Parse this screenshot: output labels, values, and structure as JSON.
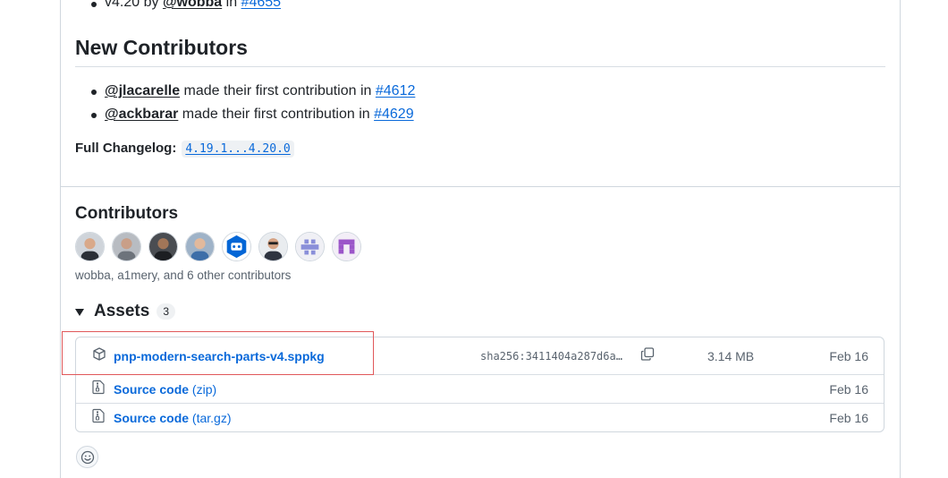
{
  "top_item": {
    "prefix": "v4.20 by ",
    "mention": "@wobba",
    "mid": " in ",
    "pr": "#4655"
  },
  "new_contributors": {
    "heading": "New Contributors",
    "items": [
      {
        "user": "@jlacarelle",
        "text": " made their first contribution in ",
        "pr": "#4612"
      },
      {
        "user": "@ackbarar",
        "text": " made their first contribution in ",
        "pr": "#4629"
      }
    ]
  },
  "changelog": {
    "label": "Full Changelog:",
    "link": "4.19.1...4.20.0"
  },
  "contributors": {
    "heading": "Contributors",
    "summary": "wobba, a1mery, and 6 other contributors"
  },
  "assets": {
    "heading": "Assets",
    "count": "3",
    "rows": [
      {
        "name": "pnp-modern-search-parts-v4.sppkg",
        "sha": "sha256:3411404a287d6a…",
        "size": "3.14 MB",
        "date": "Feb 16"
      },
      {
        "name": "Source code",
        "suffix": "(zip)",
        "date": "Feb 16"
      },
      {
        "name": "Source code",
        "suffix": "(tar.gz)",
        "date": "Feb 16"
      }
    ]
  },
  "colors": {
    "link": "#0969da",
    "text": "#1f2328",
    "muted": "#59636e",
    "border": "#d0d7de",
    "highlight": "#e0585a"
  }
}
